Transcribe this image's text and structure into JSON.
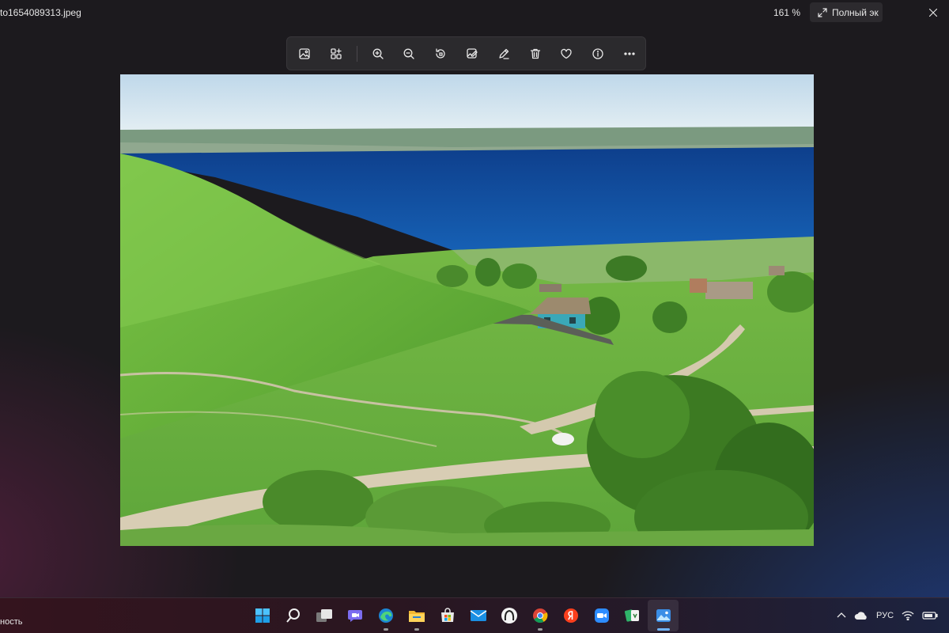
{
  "window": {
    "file_name": "to1654089313.jpeg",
    "zoom_level": "161 %",
    "fullscreen_label": "Полный эк"
  },
  "toolbar": {
    "items": [
      {
        "name": "gallery-icon"
      },
      {
        "name": "collection-icon"
      },
      {
        "name": "zoom-in-icon"
      },
      {
        "name": "zoom-out-icon"
      },
      {
        "name": "rotate-icon"
      },
      {
        "name": "edit-image-icon"
      },
      {
        "name": "draw-icon"
      },
      {
        "name": "delete-icon"
      },
      {
        "name": "favorite-icon"
      },
      {
        "name": "info-icon"
      },
      {
        "name": "more-icon"
      }
    ]
  },
  "photo": {
    "description": "landscape-photo",
    "colors": {
      "sky": "#cfe3ef",
      "water": "#0f4fa0",
      "grass": "#6cb83a",
      "road": "#d8cdb4"
    }
  },
  "taskbar": {
    "left_text": "ность",
    "apps": [
      {
        "name": "start-icon"
      },
      {
        "name": "search-icon"
      },
      {
        "name": "task-view-icon"
      },
      {
        "name": "chat-icon"
      },
      {
        "name": "edge-icon"
      },
      {
        "name": "file-explorer-icon"
      },
      {
        "name": "store-icon"
      },
      {
        "name": "mail-icon"
      },
      {
        "name": "app-icon"
      },
      {
        "name": "chrome-icon"
      },
      {
        "name": "yandex-icon"
      },
      {
        "name": "zoom-icon"
      },
      {
        "name": "solitaire-icon"
      },
      {
        "name": "photos-icon"
      }
    ],
    "tray": {
      "language": "РУС"
    }
  }
}
